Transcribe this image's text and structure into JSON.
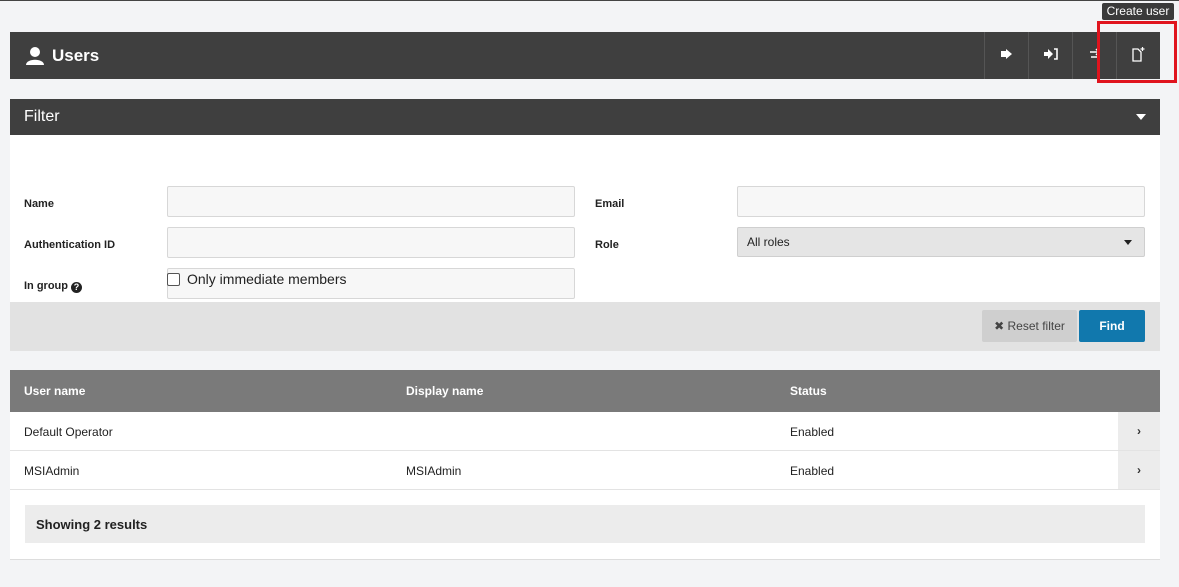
{
  "tooltip": "Create user",
  "header": {
    "title": "Users",
    "icon": "user-icon",
    "toolbar": [
      {
        "name": "export-button",
        "icon": "sign-out-icon",
        "glyph": "⇨"
      },
      {
        "name": "import-button",
        "icon": "sign-in-icon",
        "glyph": "➜"
      },
      {
        "name": "transfer-button",
        "icon": "exchange-icon",
        "glyph": "⇄"
      },
      {
        "name": "create-user-button",
        "icon": "new-file-icon",
        "glyph": "🗋"
      }
    ]
  },
  "filter": {
    "title": "Filter",
    "name_label": "Name",
    "email_label": "Email",
    "auth_label": "Authentication ID",
    "role_label": "Role",
    "role_value": "All roles",
    "group_label": "In group",
    "help_glyph": "?",
    "only_immediate": "Only immediate members",
    "reset_label": "✖ Reset filter",
    "find_label": "Find"
  },
  "table": {
    "columns": [
      "User name",
      "Display name",
      "Status"
    ],
    "rows": [
      {
        "user": "Default Operator",
        "display": "",
        "status": "Enabled"
      },
      {
        "user": "MSIAdmin",
        "display": "MSIAdmin",
        "status": "Enabled"
      }
    ],
    "row_chevron": "›",
    "results": "Showing 2 results"
  },
  "colors": {
    "header_bg": "#3f3f3f",
    "accent": "#1178ad",
    "highlight": "#e0141e"
  }
}
